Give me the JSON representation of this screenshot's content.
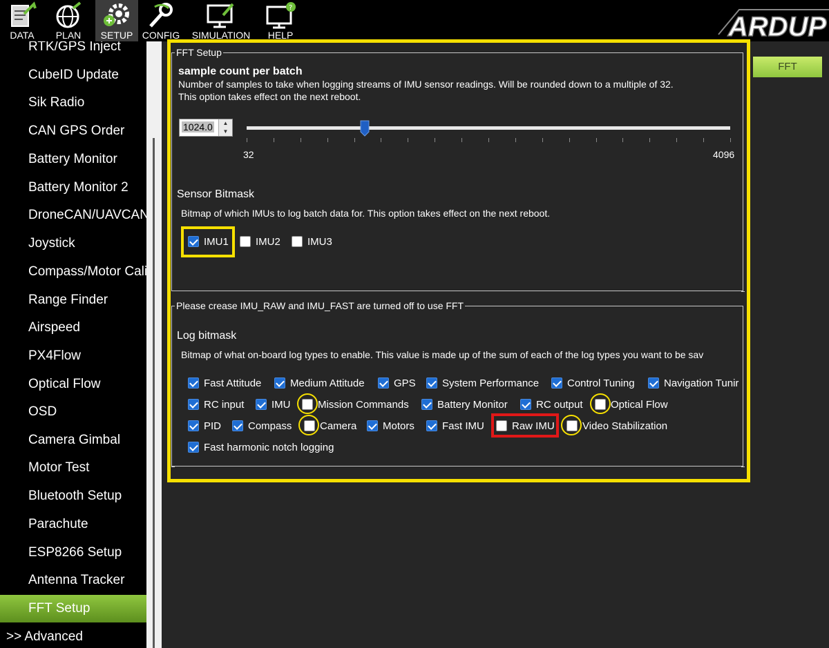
{
  "toolbar": {
    "items": [
      {
        "label": "DATA",
        "icon": "data-icon"
      },
      {
        "label": "PLAN",
        "icon": "plan-icon"
      },
      {
        "label": "SETUP",
        "icon": "setup-icon",
        "active": true
      },
      {
        "label": "CONFIG",
        "icon": "config-icon"
      },
      {
        "label": "SIMULATION",
        "icon": "simulation-icon"
      },
      {
        "label": "HELP",
        "icon": "help-icon"
      }
    ],
    "logo_text": "ARDUP"
  },
  "sidebar": {
    "items": [
      {
        "label": "RTK/GPS Inject"
      },
      {
        "label": "CubeID Update"
      },
      {
        "label": "Sik Radio"
      },
      {
        "label": "CAN GPS Order"
      },
      {
        "label": "Battery Monitor"
      },
      {
        "label": "Battery Monitor 2"
      },
      {
        "label": "DroneCAN/UAVCAN"
      },
      {
        "label": "Joystick"
      },
      {
        "label": "Compass/Motor Calib"
      },
      {
        "label": "Range Finder"
      },
      {
        "label": "Airspeed"
      },
      {
        "label": "PX4Flow"
      },
      {
        "label": "Optical Flow"
      },
      {
        "label": "OSD"
      },
      {
        "label": "Camera Gimbal"
      },
      {
        "label": "Motor Test"
      },
      {
        "label": "Bluetooth Setup"
      },
      {
        "label": "Parachute"
      },
      {
        "label": "ESP8266 Setup"
      },
      {
        "label": "Antenna Tracker"
      },
      {
        "label": "FFT Setup",
        "active": true
      },
      {
        "label": ">> Advanced"
      }
    ]
  },
  "tab_label": "FFT",
  "fft_setup": {
    "group_title": "FFT Setup",
    "sample_title": "sample count per batch",
    "sample_desc1": "Number of samples to take when logging streams of IMU sensor readings.  Will be rounded down to a multiple of 32.",
    "sample_desc2": "This option takes effect on the next reboot.",
    "spinner_value": "1024.0",
    "slider_min": "32",
    "slider_max": "4096",
    "slider_value": 1024,
    "sensor_title": "Sensor Bitmask",
    "sensor_desc": "Bitmap of which IMUs to log batch data for. This option takes effect on the next reboot.",
    "imus": [
      {
        "label": "IMU1",
        "checked": true
      },
      {
        "label": "IMU2",
        "checked": false
      },
      {
        "label": "IMU3",
        "checked": false
      }
    ]
  },
  "log_group": {
    "title": "Please crease IMU_RAW and IMU_FAST are turned off to use FFT",
    "log_title": "Log bitmask",
    "log_desc": "Bitmap of what on-board log types to enable. This value is made up of the sum of each of the log types you want to be sav",
    "rows": [
      [
        {
          "label": "Fast Attitude",
          "checked": true
        },
        {
          "label": "Medium Attitude",
          "checked": true
        },
        {
          "label": "GPS",
          "checked": true
        },
        {
          "label": "System Performance",
          "checked": true
        },
        {
          "label": "Control Tuning",
          "checked": true
        },
        {
          "label": "Navigation Tunir",
          "checked": true
        }
      ],
      [
        {
          "label": "RC input",
          "checked": true
        },
        {
          "label": "IMU",
          "checked": true
        },
        {
          "label": "Mission Commands",
          "checked": false
        },
        {
          "label": "Battery Monitor",
          "checked": true
        },
        {
          "label": "RC output",
          "checked": true
        },
        {
          "label": "Optical Flow",
          "checked": false
        }
      ],
      [
        {
          "label": "PID",
          "checked": true
        },
        {
          "label": "Compass",
          "checked": true
        },
        {
          "label": "Camera",
          "checked": false
        },
        {
          "label": "Motors",
          "checked": true
        },
        {
          "label": "Fast IMU",
          "checked": true
        },
        {
          "label": "Raw IMU",
          "checked": false
        },
        {
          "label": "Video Stabilization",
          "checked": false
        }
      ],
      [
        {
          "label": "Fast harmonic notch logging",
          "checked": true
        }
      ]
    ]
  },
  "colors": {
    "highlight": "#f7e000",
    "alert": "#e01818",
    "accent": "#8fc63f",
    "checkbox": "#1f6ed4"
  }
}
